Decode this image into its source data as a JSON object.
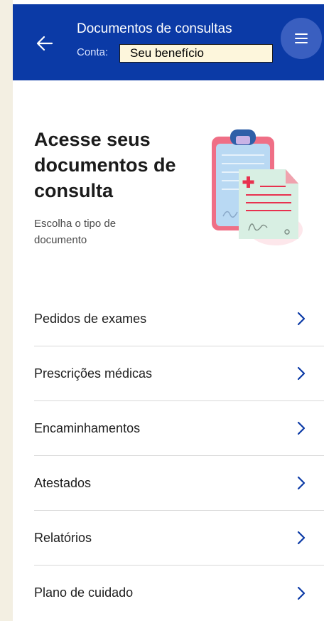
{
  "header": {
    "title": "Documentos de consultas",
    "account_label": "Conta:",
    "account_value": "Seu benefício",
    "back_icon": "arrow-left-icon",
    "menu_icon": "hamburger-menu-icon"
  },
  "hero": {
    "heading": "Acesse seus documentos de consulta",
    "subtitle": "Escolha o tipo de documento",
    "illustration_icon": "clipboard-medical-document-icon"
  },
  "document_types": [
    {
      "label": "Pedidos de exames"
    },
    {
      "label": "Prescrições médicas"
    },
    {
      "label": "Encaminhamentos"
    },
    {
      "label": "Atestados"
    },
    {
      "label": "Relatórios"
    },
    {
      "label": "Plano de cuidado"
    }
  ],
  "colors": {
    "header_bg": "#0b3aa6",
    "accent": "#0b3aa6",
    "page_bg": "#f3efe2",
    "account_field_bg": "#fdf6dc"
  }
}
